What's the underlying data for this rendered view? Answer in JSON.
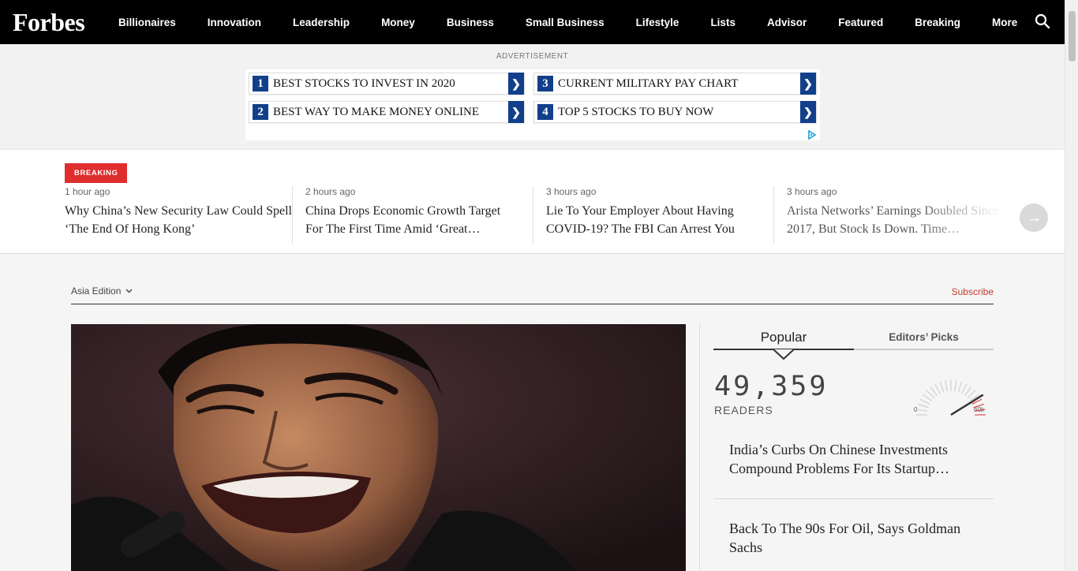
{
  "nav": {
    "logo": "Forbes",
    "items": [
      "Billionaires",
      "Innovation",
      "Leadership",
      "Money",
      "Business",
      "Small Business",
      "Lifestyle",
      "Lists",
      "Advisor",
      "Featured",
      "Breaking",
      "More"
    ],
    "search_icon": "search-icon"
  },
  "ad": {
    "label": "ADVERTISEMENT",
    "items": [
      {
        "num": "1",
        "text": "BEST STOCKS TO INVEST IN 2020"
      },
      {
        "num": "2",
        "text": "BEST WAY TO MAKE MONEY ONLINE"
      },
      {
        "num": "3",
        "text": "CURRENT MILITARY PAY CHART"
      },
      {
        "num": "4",
        "text": "TOP 5 STOCKS TO BUY NOW"
      }
    ],
    "arrow": "❯"
  },
  "breaking": {
    "badge": "BREAKING",
    "stories": [
      {
        "time": "1 hour ago",
        "headline": "Why China’s New Security Law Could Spell ‘The End Of Hong Kong’"
      },
      {
        "time": "2 hours ago",
        "headline": "China Drops Economic Growth Target For The First Time Amid ‘Great…"
      },
      {
        "time": "3 hours ago",
        "headline": "Lie To Your Employer About Having COVID-19? The FBI Can Arrest You"
      },
      {
        "time": "3 hours ago",
        "headline": "Arista Networks’ Earnings Doubled Since 2017, But Stock Is Down. Time…"
      }
    ],
    "next_arrow": "→"
  },
  "main": {
    "edition": "Asia Edition",
    "subscribe": "Subscribe",
    "tabs": {
      "popular": "Popular",
      "editors": "Editors’ Picks"
    },
    "readers": {
      "count": "49,359",
      "label": "READERS",
      "gauge_min": "0",
      "gauge_max": "60k",
      "gauge_value": 49359
    },
    "popular_items": [
      "India’s Curbs On Chinese Investments Compound Problems For Its Startup…",
      "Back To The 90s For Oil, Says Goldman Sachs"
    ]
  },
  "colors": {
    "nav_bg": "#000000",
    "ad_blue": "#123f8a",
    "breaking_red": "#e02d2d",
    "subscribe": "#c63c2f"
  }
}
